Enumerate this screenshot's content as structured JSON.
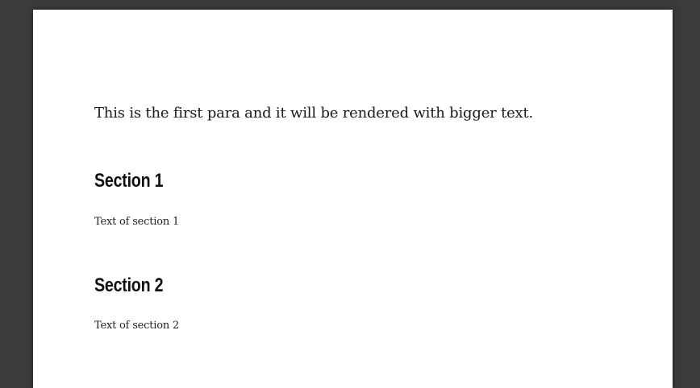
{
  "document": {
    "lead_paragraph": "This is the first para and it will be rendered with bigger text.",
    "sections": [
      {
        "heading": "Section 1",
        "text": "Text of section 1"
      },
      {
        "heading": "Section 2",
        "text": "Text of section 2"
      }
    ]
  },
  "colors": {
    "viewer_background": "#3b3b3b",
    "page_background": "#ffffff",
    "text": "#1a1a1a"
  }
}
